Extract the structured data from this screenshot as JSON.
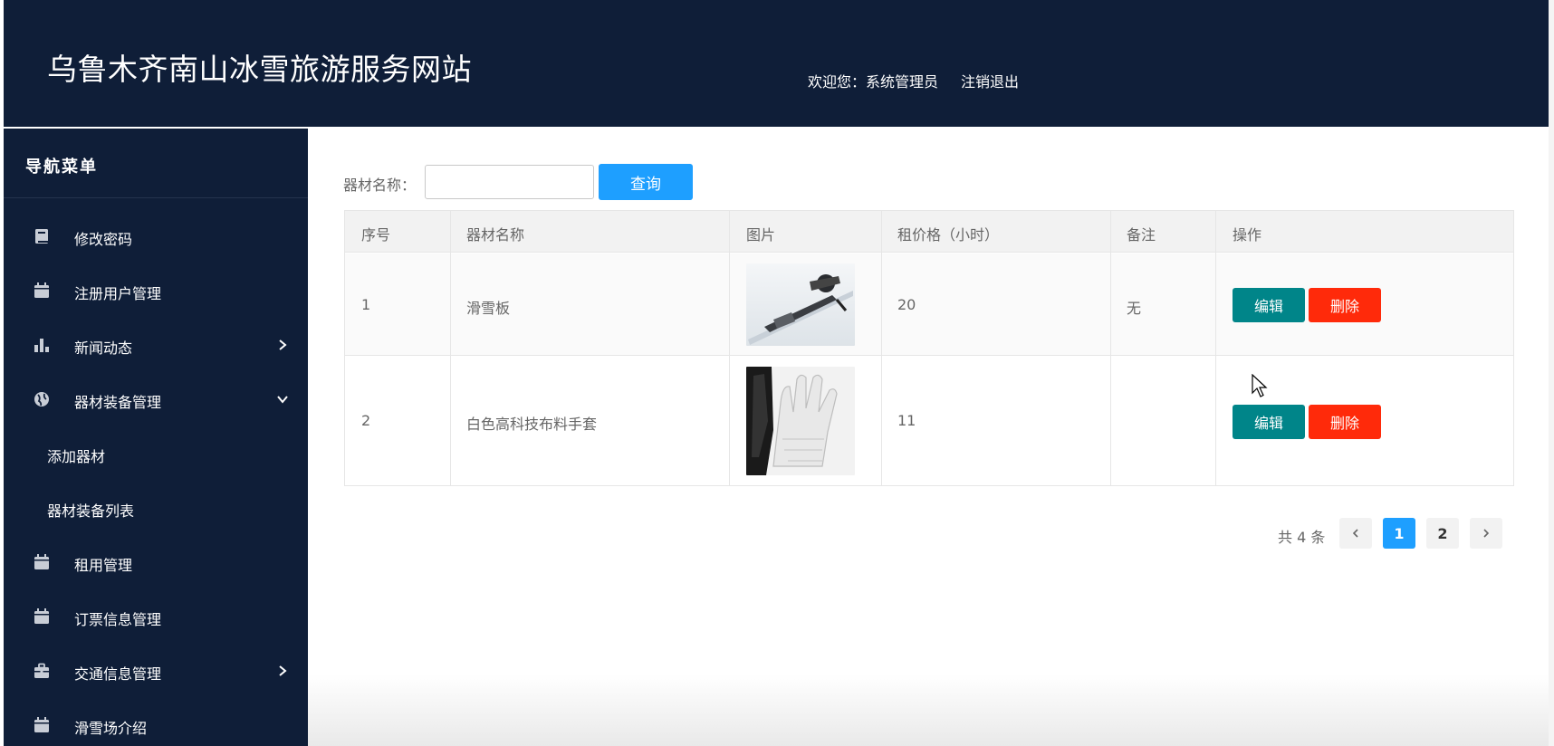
{
  "header": {
    "site_title": "乌鲁木齐南山冰雪旅游服务网站",
    "welcome": "欢迎您：系统管理员",
    "logout": "注销退出"
  },
  "sidebar": {
    "title": "导航菜单",
    "items": [
      {
        "label": "修改密码",
        "icon": "book-icon"
      },
      {
        "label": "注册用户管理",
        "icon": "calendar-icon"
      },
      {
        "label": "新闻动态",
        "icon": "bar-chart-icon",
        "arrow": "chevron-right"
      },
      {
        "label": "器材装备管理",
        "icon": "globe-icon",
        "arrow": "chevron-down"
      },
      {
        "label": "添加器材",
        "sub": true
      },
      {
        "label": "器材装备列表",
        "sub": true
      },
      {
        "label": "租用管理",
        "icon": "calendar-icon"
      },
      {
        "label": "订票信息管理",
        "icon": "calendar-icon"
      },
      {
        "label": "交通信息管理",
        "icon": "briefcase-icon",
        "arrow": "chevron-right"
      },
      {
        "label": "滑雪场介绍",
        "icon": "calendar-icon"
      }
    ]
  },
  "search": {
    "label": "器材名称：",
    "value": "",
    "placeholder": "",
    "button": "查询"
  },
  "table": {
    "headers": [
      "序号",
      "器材名称",
      "图片",
      "租价格（小时）",
      "备注",
      "操作"
    ],
    "rows": [
      {
        "no": "1",
        "name": "滑雪板",
        "image": "ski-binding-photo",
        "price": "20",
        "remark": "无",
        "edit": "编辑",
        "delete": "删除"
      },
      {
        "no": "2",
        "name": "白色高科技布料手套",
        "image": "white-glove-photo",
        "price": "11",
        "remark": "",
        "edit": "编辑",
        "delete": "删除"
      }
    ]
  },
  "pagination": {
    "total": "共 4 条",
    "pages": [
      "1",
      "2"
    ],
    "current": "1"
  },
  "colors": {
    "dark_navy": "#0f1e38",
    "primary_blue": "#1e9fff",
    "edit_teal": "#008589",
    "delete_red": "#ff2a0a"
  }
}
